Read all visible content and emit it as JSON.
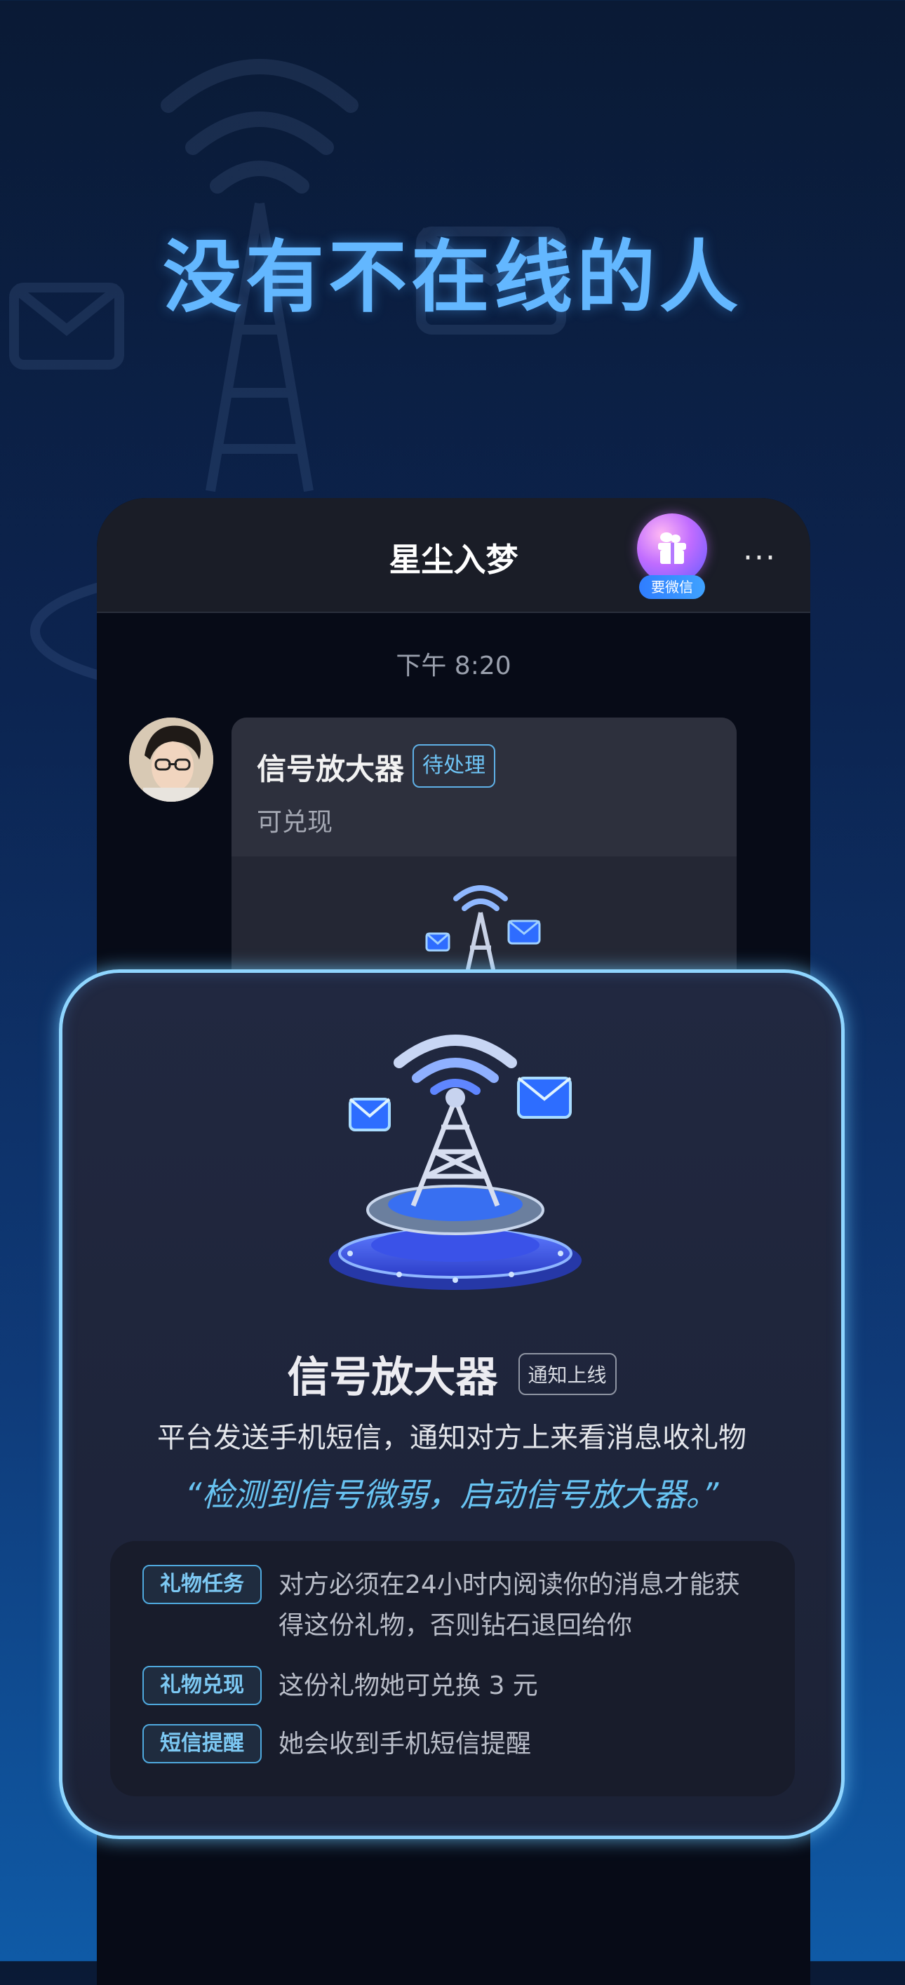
{
  "headline": "没有不在线的人",
  "chat": {
    "title": "星尘入梦",
    "gift_badge_label": "要微信",
    "more_icon": "···",
    "time": "下午 8:20",
    "message": {
      "title": "信号放大器",
      "status_tag": "待处理",
      "subtitle": "可兑现"
    }
  },
  "popup": {
    "title": "信号放大器",
    "tag": "通知上线",
    "description": "平台发送手机短信，通知对方上来看消息收礼物",
    "quote": "“检测到信号微弱，启动信号放大器。”",
    "info": [
      {
        "label": "礼物任务",
        "text": "对方必须在24小时内阅读你的消息才能获得这份礼物，否则钻石退回给你"
      },
      {
        "label": "礼物兑现",
        "text": "这份礼物她可兑换 3 元"
      },
      {
        "label": "短信提醒",
        "text": "她会收到手机短信提醒"
      }
    ]
  },
  "colors": {
    "accent_blue": "#63b7ff",
    "popup_border": "#8fd6ff",
    "tag_cyan": "#6ec3f4"
  }
}
